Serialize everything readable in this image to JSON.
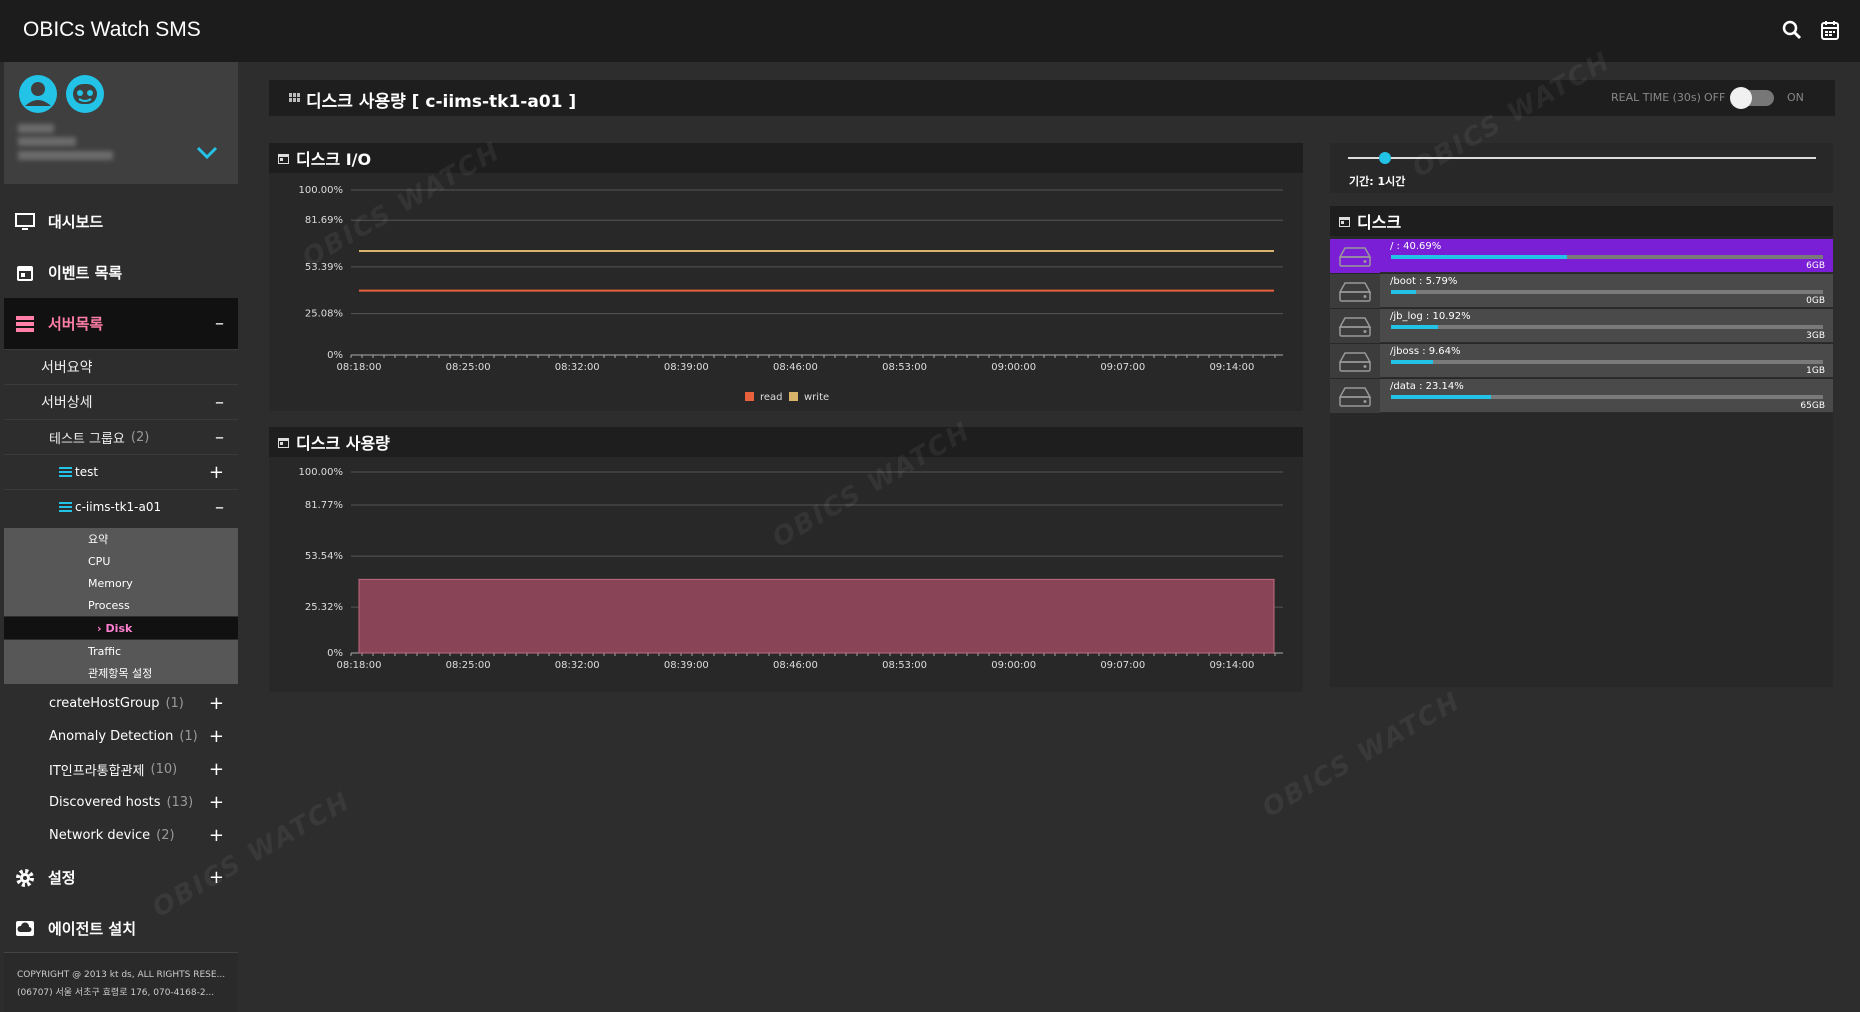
{
  "app": {
    "title": "OBICs Watch SMS"
  },
  "sidebar": {
    "menu": {
      "dashboard": "대시보드",
      "events": "이벤트 목록",
      "servers": "서버목록",
      "settings": "설정",
      "agent": "에이전트 설치"
    },
    "server_summary": "서버요약",
    "server_detail": "서버상세",
    "test_group": {
      "label": "테스트 그룹요",
      "count": "(2)"
    },
    "hosts": [
      "test",
      "c-iims-tk1-a01"
    ],
    "leaves": [
      "요약",
      "CPU",
      "Memory",
      "Process",
      "Disk",
      "Traffic",
      "관제항목 설정"
    ],
    "active_leaf_prefix": "›",
    "groups": [
      {
        "label": "createHostGroup",
        "count": "(1)"
      },
      {
        "label": "Anomaly Detection",
        "count": "(1)"
      },
      {
        "label": "IT인프라통합관제",
        "count": "(10)"
      },
      {
        "label": "Discovered hosts",
        "count": "(13)"
      },
      {
        "label": "Network device",
        "count": "(2)"
      }
    ],
    "toggles": {
      "plus": "+",
      "minus": "–"
    },
    "copyright_line1": "COPYRIGHT @ 2013 kt ds, ALL RIGHTS RESE...",
    "copyright_line2": "(06707) 서울 서초구 효령로 176, 070-4168-2..."
  },
  "page": {
    "title": "디스크 사용량 [ c-iims-tk1-a01 ]",
    "realtime_label": "REAL TIME (30s)",
    "off": "OFF",
    "on": "ON",
    "realtime_on": false
  },
  "period": {
    "label": "기간: 1시간",
    "slider_value": 0.08
  },
  "panels": {
    "io": "디스크 I/O",
    "usage": "디스크 사용량",
    "disk": "디스크"
  },
  "chart_data": [
    {
      "type": "line",
      "title": "디스크 I/O",
      "x": [
        "08:18:00",
        "08:25:00",
        "08:32:00",
        "08:39:00",
        "08:46:00",
        "08:53:00",
        "09:00:00",
        "09:07:00",
        "09:14:00"
      ],
      "yticks": [
        "100.00%",
        "81.69%",
        "53.39%",
        "25.08%",
        "0%"
      ],
      "ytick_values": [
        100,
        81.69,
        53.39,
        25.08,
        0
      ],
      "ylim": [
        0,
        100
      ],
      "series": [
        {
          "name": "read",
          "color": "#e8603c",
          "values": [
            39,
            39,
            39,
            39,
            39,
            39,
            39,
            39,
            39
          ]
        },
        {
          "name": "write",
          "color": "#d9b36a",
          "values": [
            63,
            63,
            63,
            63,
            63,
            63,
            63,
            63,
            63
          ]
        }
      ],
      "legend": "bottom"
    },
    {
      "type": "area",
      "title": "디스크 사용량",
      "x": [
        "08:18:00",
        "08:25:00",
        "08:32:00",
        "08:39:00",
        "08:46:00",
        "08:53:00",
        "09:00:00",
        "09:07:00",
        "09:14:00"
      ],
      "yticks": [
        "100.00%",
        "81.77%",
        "53.54%",
        "25.32%",
        "0%"
      ],
      "ytick_values": [
        100,
        81.77,
        53.54,
        25.32,
        0
      ],
      "ylim": [
        0,
        100
      ],
      "series": [
        {
          "name": "",
          "color": "#8a4457",
          "values": [
            40.69,
            40.69,
            40.69,
            40.69,
            40.69,
            40.69,
            40.69,
            40.69,
            40.69
          ]
        }
      ]
    }
  ],
  "disks": [
    {
      "label": "/ : 40.69%",
      "percent": 40.69,
      "size": "6GB",
      "selected": true
    },
    {
      "label": "/boot : 5.79%",
      "percent": 5.79,
      "size": "0GB",
      "selected": false
    },
    {
      "label": "/jb_log : 10.92%",
      "percent": 10.92,
      "size": "3GB",
      "selected": false
    },
    {
      "label": "/jboss : 9.64%",
      "percent": 9.64,
      "size": "1GB",
      "selected": false
    },
    {
      "label": "/data : 23.14%",
      "percent": 23.14,
      "size": "65GB",
      "selected": false
    }
  ]
}
